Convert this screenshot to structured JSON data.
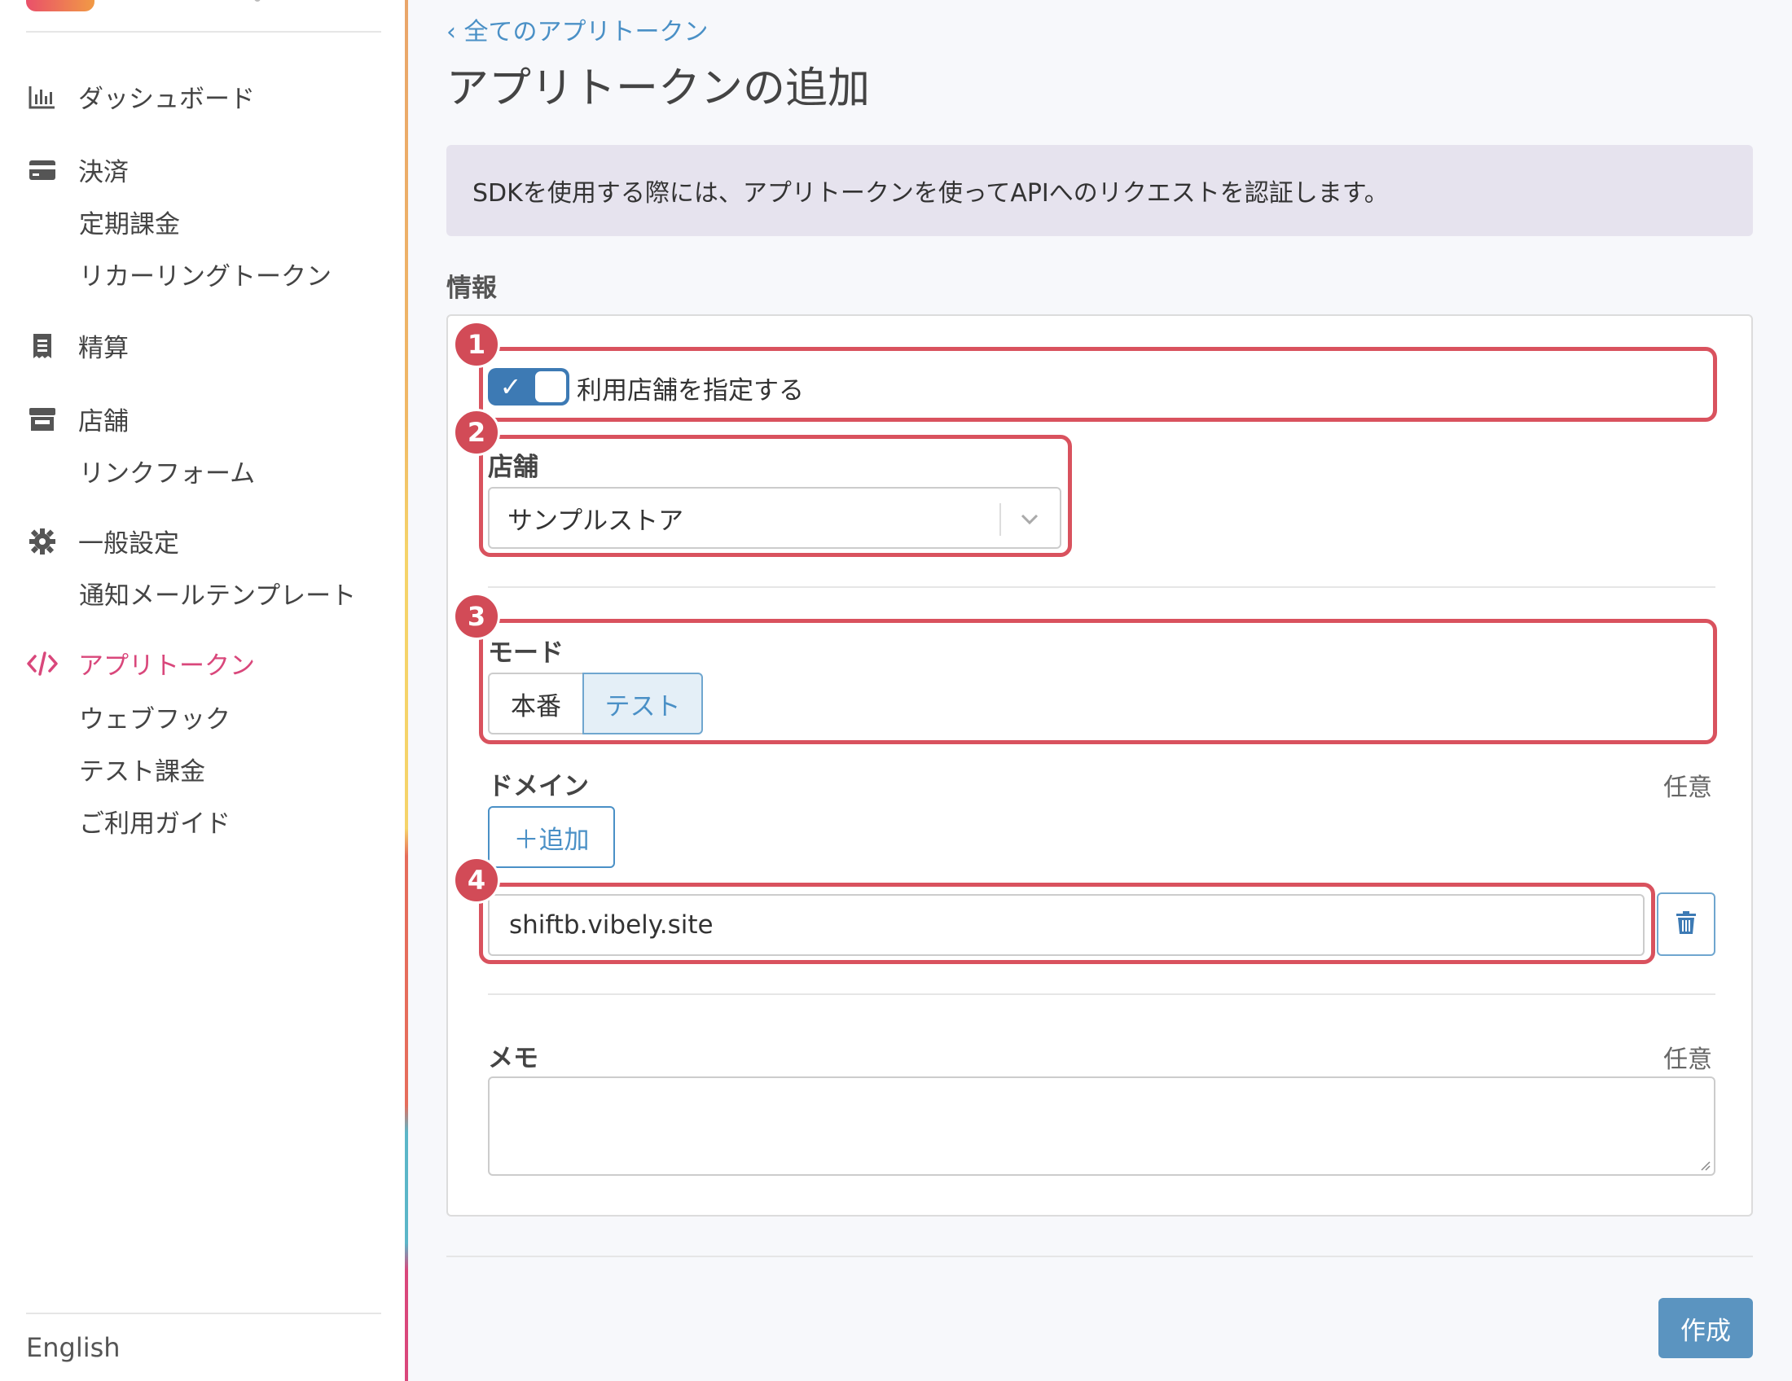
{
  "sidebar": {
    "groups": [
      {
        "label": "ダッシュボード",
        "icon": "chart-bar-icon"
      },
      {
        "label": "決済",
        "icon": "credit-card-icon",
        "items": [
          "定期課金",
          "リカーリングトークン"
        ]
      },
      {
        "label": "精算",
        "icon": "receipt-icon"
      },
      {
        "label": "店舗",
        "icon": "store-icon",
        "items": [
          "リンクフォーム"
        ]
      },
      {
        "label": "一般設定",
        "icon": "gear-icon",
        "items": [
          "通知メールテンプレート"
        ]
      },
      {
        "label": "アプリトークン",
        "icon": "code-icon",
        "items": [
          "ウェブフック",
          "テスト課金",
          "ご利用ガイド"
        ]
      }
    ],
    "active": "アプリトークン",
    "language": "English",
    "accent_color": "#d9477b"
  },
  "breadcrumb": {
    "label": "‹ 全てのアプリトークン"
  },
  "page": {
    "title": "アプリトークンの追加",
    "info": "SDKを使用する際には、アプリトークンを使ってAPIへのリクエストを認証します。",
    "section": "情報"
  },
  "form": {
    "store_toggle": {
      "label": "利用店舗を指定する",
      "checked": true
    },
    "store": {
      "label": "店舗",
      "value": "サンプルストア"
    },
    "mode": {
      "label": "モード",
      "options": [
        "本番",
        "テスト"
      ],
      "selected": "テスト"
    },
    "domain": {
      "label": "ドメイン",
      "optional": "任意",
      "add_label": "＋追加",
      "value": "shiftb.vibely.site"
    },
    "memo": {
      "label": "メモ",
      "optional": "任意",
      "value": ""
    },
    "submit_label": "作成"
  },
  "annotations": {
    "badges": [
      "1",
      "2",
      "3",
      "4"
    ],
    "color": "#d9525e"
  },
  "colors": {
    "primary": "#4a90c6",
    "button": "#5b94c0",
    "banner": "#e6e3ee"
  }
}
